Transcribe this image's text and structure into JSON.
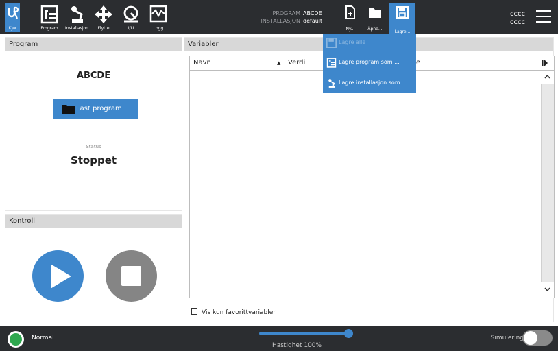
{
  "header": {
    "nav": [
      {
        "label": "Kjør",
        "icon": "ur-logo-icon"
      },
      {
        "label": "Program",
        "icon": "program-icon"
      },
      {
        "label": "Installasjon",
        "icon": "installation-icon"
      },
      {
        "label": "Flytte",
        "icon": "move-icon"
      },
      {
        "label": "I/U",
        "icon": "io-icon"
      },
      {
        "label": "Logg",
        "icon": "log-icon"
      }
    ],
    "program_label": "PROGRAM",
    "program_value": "ABCDE",
    "installation_label": "INSTALLASJON",
    "installation_value": "default",
    "file_buttons": [
      {
        "label": "Ny...",
        "icon": "new-file-icon"
      },
      {
        "label": "Åpne...",
        "icon": "open-folder-icon"
      },
      {
        "label": "Lagre...",
        "icon": "save-icon"
      }
    ],
    "user_line1": "cccc",
    "user_line2": "cccc"
  },
  "save_menu": {
    "items": [
      {
        "label": "Lagre alle",
        "enabled": false,
        "icon": "save-icon"
      },
      {
        "label": "Lagre program som ...",
        "enabled": true,
        "icon": "program-icon"
      },
      {
        "label": "Lagre installasjon som...",
        "enabled": true,
        "icon": "installation-icon"
      }
    ]
  },
  "program_panel": {
    "title": "Program",
    "program_name": "ABCDE",
    "load_button": "Last program",
    "status_label": "Status",
    "status_value": "Stoppet"
  },
  "control_panel": {
    "title": "Kontroll"
  },
  "variables_panel": {
    "title": "Variabler",
    "columns": [
      "Navn",
      "Verdi",
      "lse"
    ],
    "sort_indicator": "▲",
    "rows": [],
    "favorites_only_label": "Vis kun favorittvariabler",
    "favorites_only_checked": false
  },
  "footer": {
    "robot_status": "Normal",
    "speed_label": "Hastighet 100%",
    "speed_percent": 100,
    "simulation_label": "Simulering",
    "simulation_on": false
  },
  "colors": {
    "accent": "#3e87cc",
    "topbar": "#2b2d30",
    "status_green": "#2fa84f"
  }
}
